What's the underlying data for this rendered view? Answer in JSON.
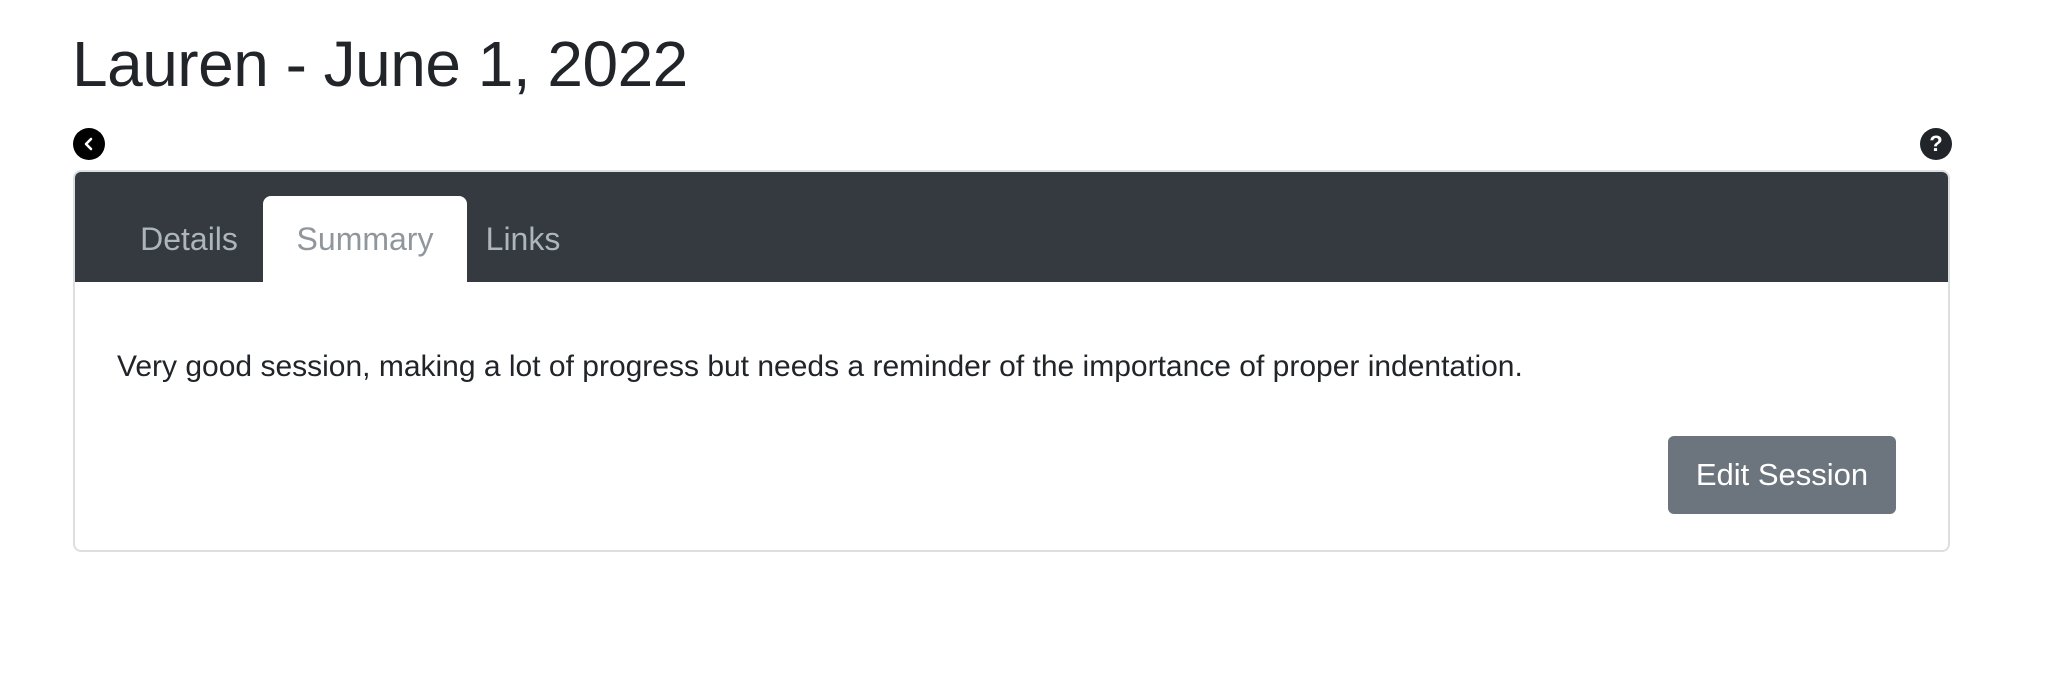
{
  "page": {
    "title": "Lauren - June 1, 2022"
  },
  "navigation": {
    "back_icon": "chevron-left-icon",
    "help_icon": "question-mark-icon",
    "help_glyph": "?"
  },
  "tabs": [
    {
      "label": "Details",
      "active": false
    },
    {
      "label": "Summary",
      "active": true
    },
    {
      "label": "Links",
      "active": false
    }
  ],
  "summary": {
    "text": "Very good session, making a lot of progress but needs a reminder of the importance of proper indentation."
  },
  "actions": {
    "edit_label": "Edit Session"
  },
  "colors": {
    "header_bg": "#343a40",
    "button_bg": "#6c757d",
    "tab_text": "#adb5bd"
  }
}
